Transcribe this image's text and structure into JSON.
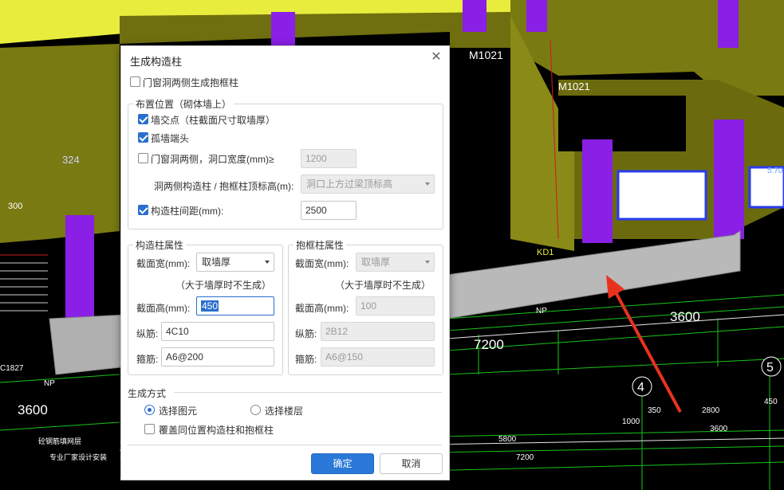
{
  "dialog": {
    "title": "生成构造柱",
    "opening_pillar_option": {
      "label": "门窗洞两侧生成抱框柱",
      "checked": false
    },
    "placement": {
      "legend": "布置位置（砌体墙上）",
      "wall_intersection": {
        "label": "墙交点（柱截面尺寸取墙厚）",
        "checked": true
      },
      "isolated_wall_end": {
        "label": "孤墙端头",
        "checked": true
      },
      "opening_sides": {
        "label": "门窗洞两侧，洞口宽度(mm)≥",
        "checked": false,
        "value": "1200"
      },
      "top_elevation": {
        "label": "洞两侧构造柱 / 抱框柱顶标高(m):",
        "value": "洞口上方过梁顶标高"
      },
      "spacing": {
        "label": "构造柱间距(mm):",
        "checked": true,
        "value": "2500"
      }
    },
    "column_props": {
      "legend": "构造柱属性",
      "width_label": "截面宽(mm):",
      "width_value": "取墙厚",
      "note": "（大于墙厚时不生成）",
      "height_label": "截面高(mm):",
      "height_value": "450",
      "long_bar_label": "纵筋:",
      "long_bar_value": "4C10",
      "stirrup_label": "箍筋:",
      "stirrup_value": "A6@200"
    },
    "frame_props": {
      "legend": "抱框柱属性",
      "width_label": "截面宽(mm):",
      "width_value": "取墙厚",
      "note": "（大于墙厚时不生成）",
      "height_label": "截面高(mm):",
      "height_value": "100",
      "long_bar_label": "纵筋:",
      "long_bar_value": "2B12",
      "stirrup_label": "箍筋:",
      "stirrup_value": "A6@150"
    },
    "generate_mode": {
      "legend": "生成方式",
      "select_element": {
        "label": "选择图元",
        "selected": true
      },
      "select_floor": {
        "label": "选择楼层",
        "selected": false
      },
      "overwrite": {
        "label": "覆盖同位置构造柱和抱框柱",
        "checked": false
      }
    },
    "ok_label": "确定",
    "cancel_label": "取消"
  },
  "scene": {
    "labels": {
      "m1021_a": "M1021",
      "m1021_b": "M1021",
      "d324": "324",
      "d300": "300",
      "kd1": "KD1",
      "np_a": "NP",
      "np_b": "NP",
      "c1827": "C1827",
      "dim_3600_right": "3600",
      "dim_7200_right": "7200",
      "axis_4": "4",
      "axis_5": "5",
      "dim_1000": "1000",
      "dim_350": "350",
      "dim_2800": "2800",
      "dim_450": "450",
      "dim_3600_bottom": "3600",
      "dim_5800": "5800",
      "dim_7200_bottom": "7200",
      "dim_3600_left": "3600",
      "drawing_title": "砼钢筋填网层",
      "drawing_sub": "专业厂家设计安装",
      "dim_570": "5.70"
    }
  },
  "colors": {
    "wall": "#7a7a12",
    "column": "#8a1fe6",
    "slab": "#e8ec3c",
    "new_column": "#b9b9b9",
    "arrow": "#e8321e",
    "accent": "#2a6fcc"
  }
}
